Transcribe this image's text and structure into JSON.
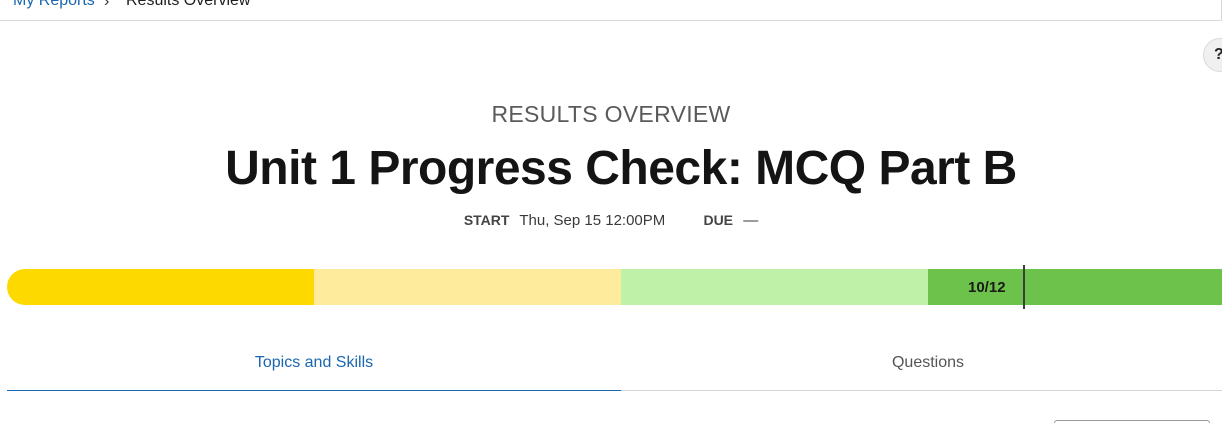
{
  "breadcrumb": {
    "parent": "My Reports",
    "separator": "›",
    "current": "Results Overview"
  },
  "help": {
    "label": "?"
  },
  "header": {
    "overline": "RESULTS OVERVIEW",
    "title": "Unit 1 Progress Check: MCQ Part B",
    "start_label": "START",
    "start_value": "Thu, Sep 15 12:00PM",
    "due_label": "DUE",
    "due_value": "—"
  },
  "progress": {
    "score": "10/12",
    "fraction": 0.833,
    "colors": [
      "#fdd900",
      "#ffeb9c",
      "#bff2a8",
      "#6cc24a"
    ]
  },
  "tabs": [
    {
      "label": "Topics and Skills",
      "active": true
    },
    {
      "label": "Questions",
      "active": false
    }
  ],
  "colors": {
    "accent": "#1a66b0"
  }
}
